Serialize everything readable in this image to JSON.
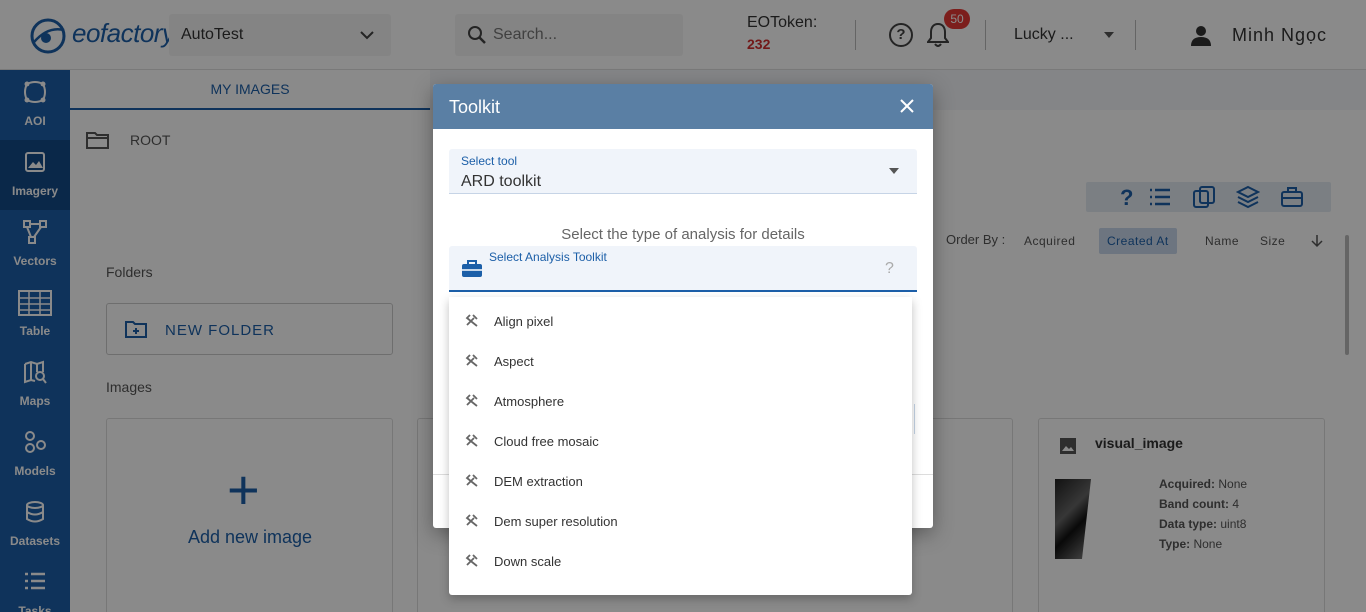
{
  "header": {
    "logo_text": "eofactory",
    "project": "AutoTest",
    "search_placeholder": "Search...",
    "token_label": "EOToken:",
    "token_value": "232",
    "notification_count": "50",
    "org": "Lucky ...",
    "user_name": "Minh Ngọc"
  },
  "sidebar": {
    "items": [
      {
        "label": "AOI",
        "icon": "aoi-icon"
      },
      {
        "label": "Imagery",
        "icon": "imagery-icon"
      },
      {
        "label": "Vectors",
        "icon": "vectors-icon"
      },
      {
        "label": "Table",
        "icon": "table-icon"
      },
      {
        "label": "Maps",
        "icon": "maps-icon"
      },
      {
        "label": "Models",
        "icon": "models-icon"
      },
      {
        "label": "Datasets",
        "icon": "datasets-icon"
      },
      {
        "label": "Tasks",
        "icon": "tasks-icon"
      }
    ],
    "active": "Imagery"
  },
  "main": {
    "tabs": [
      "MY IMAGES"
    ],
    "breadcrumb": "ROOT",
    "folders_label": "Folders",
    "new_folder_label": "NEW FOLDER",
    "images_label": "Images",
    "add_image_label": "Add new image",
    "order_by_label": "Order By :",
    "order_options": [
      "Acquired",
      "Created At",
      "Name",
      "Size"
    ],
    "order_active": "Created At",
    "visual_card": {
      "title": "visual_image",
      "acquired_label": "Acquired:",
      "acquired_value": "None",
      "band_label": "Band count:",
      "band_value": "4",
      "dtype_label": "Data type:",
      "dtype_value": "uint8",
      "type_label": "Type:",
      "type_value": "None"
    }
  },
  "dialog": {
    "title": "Toolkit",
    "select_tool_label": "Select tool",
    "select_tool_value": "ARD toolkit",
    "hint": "Select the type of analysis for details",
    "analysis_label": "Select Analysis Toolkit",
    "analysis_help": "?",
    "options": [
      "Align pixel",
      "Aspect",
      "Atmosphere",
      "Cloud free mosaic",
      "DEM extraction",
      "Dem super resolution",
      "Down scale"
    ]
  },
  "colors": {
    "brand": "#1c5fa8",
    "dialog_header": "#5a7fa4",
    "badge": "#e53935"
  }
}
